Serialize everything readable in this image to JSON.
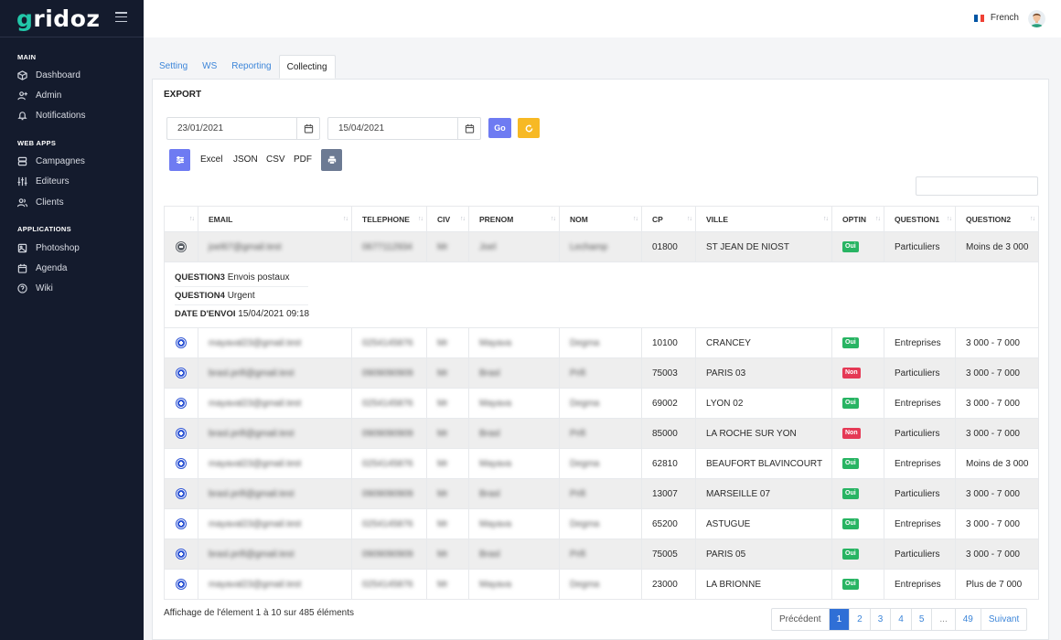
{
  "brand": {
    "logo_g": "g",
    "logo_rest": "ridoz"
  },
  "sidebar": {
    "sections": [
      {
        "label": "MAIN",
        "items": [
          {
            "label": "Dashboard",
            "icon": "cube-icon"
          },
          {
            "label": "Admin",
            "icon": "user-plus-icon"
          },
          {
            "label": "Notifications",
            "icon": "bell-icon"
          }
        ]
      },
      {
        "label": "WEB APPS",
        "items": [
          {
            "label": "Campagnes",
            "icon": "server-icon"
          },
          {
            "label": "Editeurs",
            "icon": "sliders-icon"
          },
          {
            "label": "Clients",
            "icon": "users-icon"
          }
        ]
      },
      {
        "label": "APPLICATIONS",
        "items": [
          {
            "label": "Photoshop",
            "icon": "image-icon"
          },
          {
            "label": "Agenda",
            "icon": "calendar-icon"
          },
          {
            "label": "Wiki",
            "icon": "help-circle-icon"
          }
        ]
      }
    ]
  },
  "topbar": {
    "language": "French",
    "flag_colors": [
      "#0055a4",
      "#ffffff",
      "#ef4135"
    ]
  },
  "tabs": [
    {
      "label": "Setting",
      "active": false
    },
    {
      "label": "WS",
      "active": false
    },
    {
      "label": "Reporting",
      "active": false
    },
    {
      "label": "Collecting",
      "active": true
    }
  ],
  "export": {
    "title": "EXPORT",
    "date_from": "23/01/2021",
    "date_to": "15/04/2021",
    "go_label": "Go",
    "buttons": [
      "Excel",
      "JSON",
      "CSV",
      "PDF"
    ]
  },
  "table": {
    "columns": [
      "",
      "EMAIL",
      "TELEPHONE",
      "CIV",
      "PRENOM",
      "NOM",
      "CP",
      "VILLE",
      "OPTIN",
      "QUESTION1",
      "QUESTION2"
    ],
    "rows": [
      {
        "email": "joel67@gmail.test",
        "telephone": "0677112934",
        "civ": "Mr",
        "prenom": "Joel",
        "nom": "Lechamp",
        "cp": "01800",
        "ville": "ST JEAN DE NIOST",
        "optin": "Oui",
        "q1": "Particuliers",
        "q2": "Moins de 3 000",
        "expanded": true
      },
      {
        "email": "mayaval23@gmail.test",
        "telephone": "0254145876",
        "civ": "Mr",
        "prenom": "Mayava",
        "nom": "Degma",
        "cp": "10100",
        "ville": "CRANCEY",
        "optin": "Oui",
        "q1": "Entreprises",
        "q2": "3 000 - 7 000"
      },
      {
        "email": "brasl.prifi@gmail.test",
        "telephone": "0909090909",
        "civ": "Mr",
        "prenom": "Brasl",
        "nom": "Prifi",
        "cp": "75003",
        "ville": "PARIS 03",
        "optin": "Non",
        "q1": "Particuliers",
        "q2": "3 000 - 7 000"
      },
      {
        "email": "mayaval23@gmail.test",
        "telephone": "0254145876",
        "civ": "Mr",
        "prenom": "Mayava",
        "nom": "Degma",
        "cp": "69002",
        "ville": "LYON 02",
        "optin": "Oui",
        "q1": "Entreprises",
        "q2": "3 000 - 7 000"
      },
      {
        "email": "brasl.prifi@gmail.test",
        "telephone": "0909090909",
        "civ": "Mr",
        "prenom": "Brasl",
        "nom": "Prifi",
        "cp": "85000",
        "ville": "LA ROCHE SUR YON",
        "optin": "Non",
        "q1": "Particuliers",
        "q2": "3 000 - 7 000"
      },
      {
        "email": "mayaval23@gmail.test",
        "telephone": "0254145876",
        "civ": "Mr",
        "prenom": "Mayava",
        "nom": "Degma",
        "cp": "62810",
        "ville": "BEAUFORT BLAVINCOURT",
        "optin": "Oui",
        "q1": "Entreprises",
        "q2": "Moins de 3 000"
      },
      {
        "email": "brasl.prifi@gmail.test",
        "telephone": "0909090909",
        "civ": "Mr",
        "prenom": "Brasl",
        "nom": "Prifi",
        "cp": "13007",
        "ville": "MARSEILLE 07",
        "optin": "Oui",
        "q1": "Particuliers",
        "q2": "3 000 - 7 000"
      },
      {
        "email": "mayaval23@gmail.test",
        "telephone": "0254145876",
        "civ": "Mr",
        "prenom": "Mayava",
        "nom": "Degma",
        "cp": "65200",
        "ville": "ASTUGUE",
        "optin": "Oui",
        "q1": "Entreprises",
        "q2": "3 000 - 7 000"
      },
      {
        "email": "brasl.prifi@gmail.test",
        "telephone": "0909090909",
        "civ": "Mr",
        "prenom": "Brasl",
        "nom": "Prifi",
        "cp": "75005",
        "ville": "PARIS 05",
        "optin": "Oui",
        "q1": "Particuliers",
        "q2": "3 000 - 7 000"
      },
      {
        "email": "mayaval23@gmail.test",
        "telephone": "0254145876",
        "civ": "Mr",
        "prenom": "Mayava",
        "nom": "Degma",
        "cp": "23000",
        "ville": "LA BRIONNE",
        "optin": "Oui",
        "q1": "Entreprises",
        "q2": "Plus de 7 000"
      }
    ],
    "detail": [
      {
        "label": "QUESTION3",
        "value": "Envois postaux"
      },
      {
        "label": "QUESTION4",
        "value": "Urgent"
      },
      {
        "label": "DATE D'ENVOI",
        "value": "15/04/2021 09:18"
      }
    ]
  },
  "footer": {
    "info": "Affichage de l'élement 1 à 10 sur 485 éléments",
    "pagination": {
      "prev": "Précédent",
      "pages": [
        "1",
        "2",
        "3",
        "4",
        "5",
        "...",
        "49"
      ],
      "active": "1",
      "next": "Suivant"
    }
  }
}
